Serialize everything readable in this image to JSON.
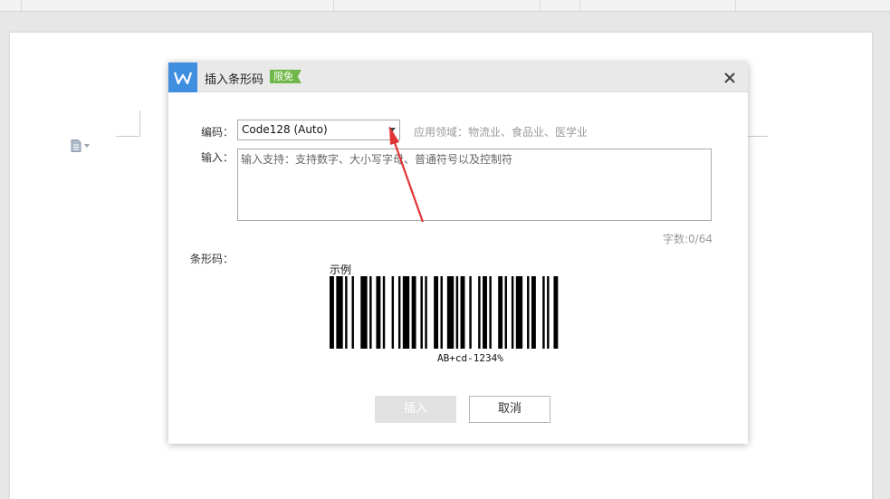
{
  "dialog": {
    "title": "插入条形码",
    "free_tag": "限免",
    "encoding_label": "编码：",
    "encoding_value": "Code128 (Auto)",
    "application_hint": "应用领域：物流业、食品业、医学业",
    "input_label": "输入：",
    "input_placeholder": "输入支持：支持数字、大小写字母、普通符号以及控制符",
    "char_count": "字数:0/64",
    "barcode_label": "条形码：",
    "sample_label": "示例",
    "barcode_text": "AB+cd-1234%",
    "insert_button": "插入",
    "cancel_button": "取消"
  },
  "colors": {
    "logo": "#3f8ee0",
    "free_tag": "#70b84a",
    "annotation_arrow": "#e03434"
  },
  "icons": [
    "wps-logo-icon",
    "close-icon",
    "chevron-down-icon",
    "document-icon"
  ]
}
